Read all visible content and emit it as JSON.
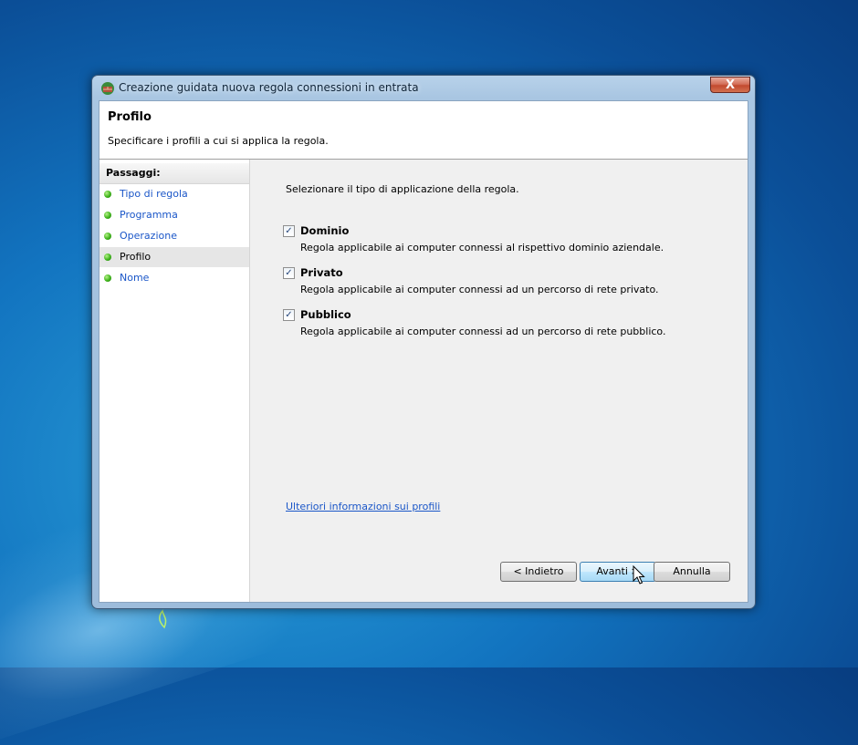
{
  "window": {
    "title": "Creazione guidata nuova regola connessioni in entrata",
    "close_label": "X"
  },
  "header": {
    "title": "Profilo",
    "subtitle": "Specificare i profili a cui si applica la regola."
  },
  "steps": {
    "heading": "Passaggi:",
    "items": [
      {
        "label": "Tipo di regola",
        "current": false
      },
      {
        "label": "Programma",
        "current": false
      },
      {
        "label": "Operazione",
        "current": false
      },
      {
        "label": "Profilo",
        "current": true
      },
      {
        "label": "Nome",
        "current": false
      }
    ]
  },
  "content": {
    "instruction": "Selezionare il tipo di applicazione della regola.",
    "options": [
      {
        "label": "Dominio",
        "description": "Regola applicabile ai computer connessi al rispettivo dominio aziendale.",
        "checked": true
      },
      {
        "label": "Privato",
        "description": "Regola applicabile ai computer connessi ad un percorso di rete privato.",
        "checked": true
      },
      {
        "label": "Pubblico",
        "description": "Regola applicabile ai computer connessi ad un percorso di rete pubblico.",
        "checked": true
      }
    ],
    "link": "Ulteriori informazioni sui profili"
  },
  "buttons": {
    "back": "< Indietro",
    "next": "Avanti >",
    "cancel": "Annulla"
  },
  "colors": {
    "link": "#1a56c8",
    "step_dot": "#3fb41b",
    "close_button": "#c24a2f"
  }
}
